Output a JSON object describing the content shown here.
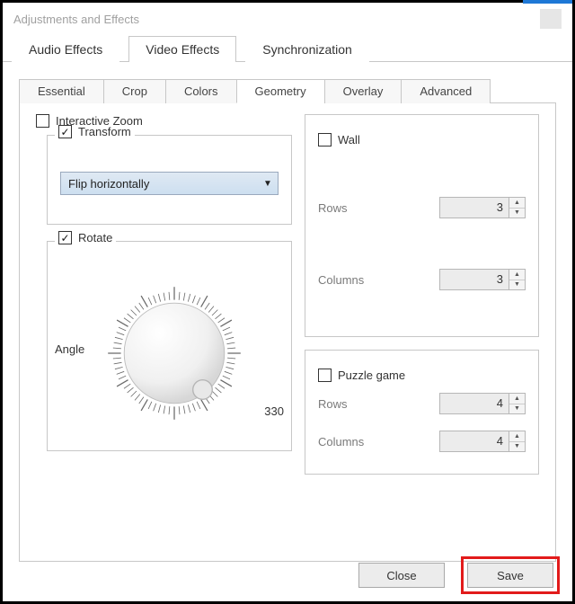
{
  "window": {
    "title": "Adjustments and Effects"
  },
  "main_tabs": {
    "audio": "Audio Effects",
    "video": "Video Effects",
    "sync": "Synchronization"
  },
  "sub_tabs": {
    "essential": "Essential",
    "crop": "Crop",
    "colors": "Colors",
    "geometry": "Geometry",
    "overlay": "Overlay",
    "advanced": "Advanced"
  },
  "geo": {
    "interactive_zoom": {
      "label": "Interactive Zoom",
      "checked": false
    },
    "transform": {
      "label": "Transform",
      "checked": true,
      "selected": "Flip horizontally"
    },
    "rotate": {
      "label": "Rotate",
      "checked": true,
      "angle_label": "Angle",
      "angle_value": "330"
    },
    "wall": {
      "label": "Wall",
      "checked": false,
      "rows_label": "Rows",
      "rows_value": "3",
      "cols_label": "Columns",
      "cols_value": "3"
    },
    "puzzle": {
      "label": "Puzzle game",
      "checked": false,
      "rows_label": "Rows",
      "rows_value": "4",
      "cols_label": "Columns",
      "cols_value": "4"
    }
  },
  "footer": {
    "close": "Close",
    "save": "Save"
  }
}
